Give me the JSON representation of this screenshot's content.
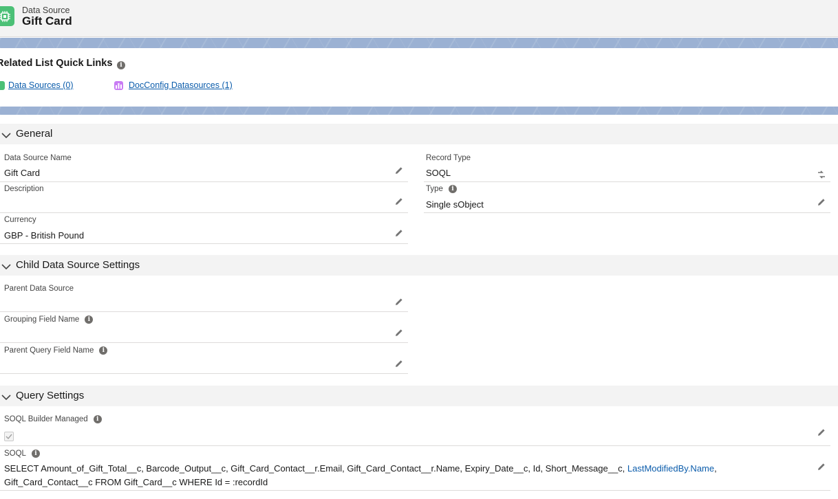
{
  "header": {
    "object_type": "Data Source",
    "record_title": "Gift Card",
    "icon": "chip-icon"
  },
  "quick_links": {
    "title": "Related List Quick Links",
    "links": [
      {
        "label": "Data Sources (0)",
        "icon": "data-source-icon",
        "color": "#4bc076"
      },
      {
        "label": "DocConfig Datasources (1)",
        "icon": "docconfig-icon",
        "color": "#c97cf4"
      }
    ]
  },
  "sections": {
    "general": {
      "title": "General",
      "fields": {
        "data_source_name": {
          "label": "Data Source Name",
          "value": "Gift Card"
        },
        "record_type": {
          "label": "Record Type",
          "value": "SOQL"
        },
        "description": {
          "label": "Description",
          "value": ""
        },
        "type": {
          "label": "Type",
          "value": "Single sObject"
        },
        "currency": {
          "label": "Currency",
          "value": "GBP - British Pound"
        }
      }
    },
    "child": {
      "title": "Child Data Source Settings",
      "fields": {
        "parent_data_source": {
          "label": "Parent Data Source",
          "value": ""
        },
        "grouping_field_name": {
          "label": "Grouping Field Name",
          "value": ""
        },
        "parent_query_field_name": {
          "label": "Parent Query Field Name",
          "value": ""
        }
      }
    },
    "query": {
      "title": "Query Settings",
      "fields": {
        "soql_builder_managed": {
          "label": "SOQL Builder Managed",
          "checked": true
        },
        "soql": {
          "label": "SOQL",
          "value_prefix": "SELECT Amount_of_Gift_Total__c, Barcode_Output__c, Gift_Card_Contact__r.Email, Gift_Card_Contact__r.Name, Expiry_Date__c, Id, Short_Message__c, ",
          "value_link": "LastModifiedBy.Name",
          "value_suffix": ", Gift_Card_Contact__c FROM Gift_Card__c WHERE Id = :recordId"
        }
      }
    }
  },
  "colors": {
    "link": "#0b5cab",
    "section_bg": "#f3f3f3",
    "brand_band": "#4a73b0"
  }
}
